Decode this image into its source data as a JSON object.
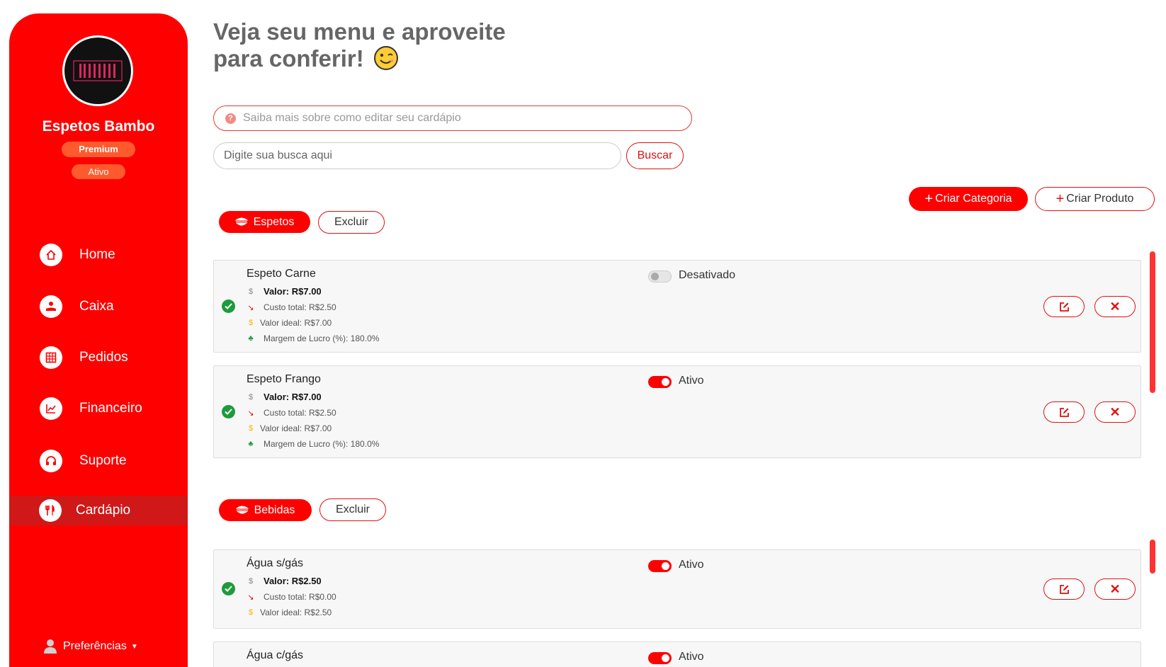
{
  "sidebar": {
    "store_name": "Espetos Bambo",
    "logo_text": "BAMBOO",
    "plan_badge": "Premium",
    "status_badge": "Ativo",
    "nav": [
      {
        "label": "Home",
        "icon": "home-icon"
      },
      {
        "label": "Caixa",
        "icon": "cash-register-icon"
      },
      {
        "label": "Pedidos",
        "icon": "orders-grid-icon"
      },
      {
        "label": "Financeiro",
        "icon": "chart-line-icon"
      },
      {
        "label": "Suporte",
        "icon": "headset-icon"
      },
      {
        "label": "Cardápio",
        "icon": "utensils-icon",
        "active": true
      }
    ],
    "preferences_label": "Preferências"
  },
  "header": {
    "title_line1": "Veja seu menu e aproveite",
    "title_line2": "para conferir!"
  },
  "help": {
    "text": "Saiba mais sobre como editar seu cardápio"
  },
  "search": {
    "placeholder": "Digite sua busca aqui",
    "button": "Buscar"
  },
  "actions": {
    "create_category": "Criar Categoria",
    "create_product": "Criar Produto"
  },
  "delete_label": "Excluir",
  "colors": {
    "primary": "#ff0000",
    "accent": "#ff5a2d",
    "success": "#1e9b3c"
  },
  "categories": [
    {
      "name": "Espetos",
      "products": [
        {
          "name": "Espeto Carne",
          "status": "Desativado",
          "enabled": false,
          "value": "Valor: R$7.00",
          "cost": "Custo total: R$2.50",
          "ideal": "Valor ideal: R$7.00",
          "margin": "Margem de Lucro (%): 180.0%"
        },
        {
          "name": "Espeto Frango",
          "status": "Ativo",
          "enabled": true,
          "value": "Valor: R$7.00",
          "cost": "Custo total: R$2.50",
          "ideal": "Valor ideal: R$7.00",
          "margin": "Margem de Lucro (%): 180.0%"
        }
      ]
    },
    {
      "name": "Bebidas",
      "products": [
        {
          "name": "Água s/gás",
          "status": "Ativo",
          "enabled": true,
          "value": "Valor: R$2.50",
          "cost": "Custo total: R$0.00",
          "ideal": "Valor ideal: R$2.50"
        },
        {
          "name": "Água c/gás",
          "status": "Ativo",
          "enabled": true
        }
      ]
    }
  ]
}
